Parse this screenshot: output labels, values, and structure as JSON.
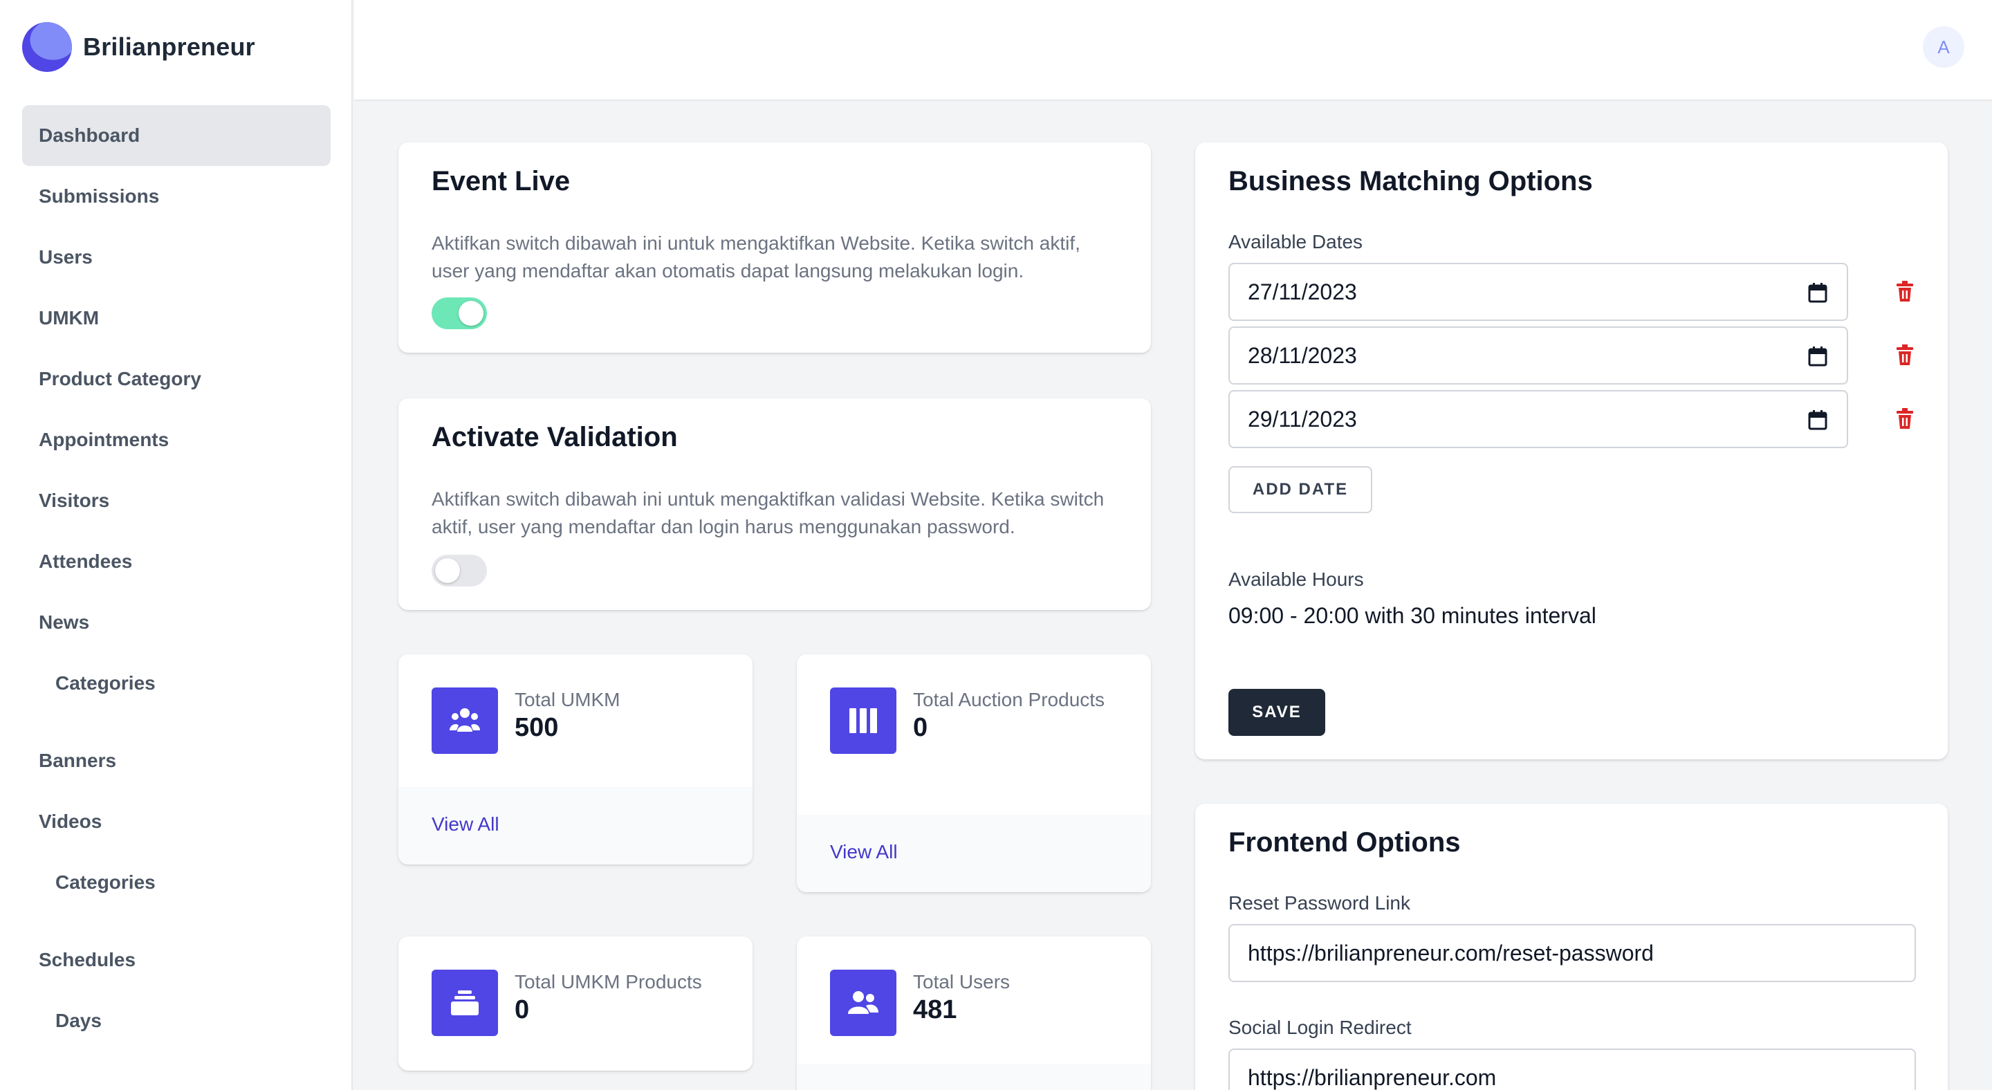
{
  "brand": {
    "name": "Brilianpreneur"
  },
  "sidebar": {
    "items": [
      {
        "label": "Dashboard"
      },
      {
        "label": "Submissions"
      },
      {
        "label": "Users"
      },
      {
        "label": "UMKM"
      },
      {
        "label": "Product Category"
      },
      {
        "label": "Appointments"
      },
      {
        "label": "Visitors"
      },
      {
        "label": "Attendees"
      },
      {
        "label": "News"
      },
      {
        "label": "Categories"
      },
      {
        "label": "Banners"
      },
      {
        "label": "Videos"
      },
      {
        "label": "Categories"
      },
      {
        "label": "Schedules"
      },
      {
        "label": "Days"
      }
    ]
  },
  "header": {
    "avatar_initial": "A"
  },
  "event_live": {
    "title": "Event Live",
    "description": "Aktifkan switch dibawah ini untuk mengaktifkan Website. Ketika switch aktif, user yang mendaftar akan otomatis dapat langsung melakukan login.",
    "enabled": true
  },
  "activate_validation": {
    "title": "Activate Validation",
    "description": "Aktifkan switch dibawah ini untuk mengaktifkan validasi Website. Ketika switch aktif, user yang mendaftar dan login harus menggunakan password.",
    "enabled": false
  },
  "stats": [
    {
      "label": "Total UMKM",
      "value": "500",
      "link": "View All",
      "icon": "users-group-icon"
    },
    {
      "label": "Total Auction Products",
      "value": "0",
      "link": "View All",
      "icon": "columns-icon"
    },
    {
      "label": "Total UMKM Products",
      "value": "0",
      "icon": "inbox-stack-icon"
    },
    {
      "label": "Total Users",
      "value": "481",
      "icon": "users-icon"
    }
  ],
  "business_matching": {
    "title": "Business Matching Options",
    "dates_label": "Available Dates",
    "dates": [
      "27/11/2023",
      "28/11/2023",
      "29/11/2023"
    ],
    "add_date_label": "ADD DATE",
    "hours_label": "Available Hours",
    "hours_value": "09:00 - 20:00 with 30 minutes interval",
    "save_label": "SAVE"
  },
  "frontend_options": {
    "title": "Frontend Options",
    "reset_label": "Reset Password Link",
    "reset_value": "https://brilianpreneur.com/reset-password",
    "social_label": "Social Login Redirect",
    "social_value": "https://brilianpreneur.com"
  },
  "colors": {
    "accent": "#4f46e5",
    "toggle_on": "#6ee7b7",
    "danger": "#dc2626",
    "dark_button": "#1f2937"
  }
}
